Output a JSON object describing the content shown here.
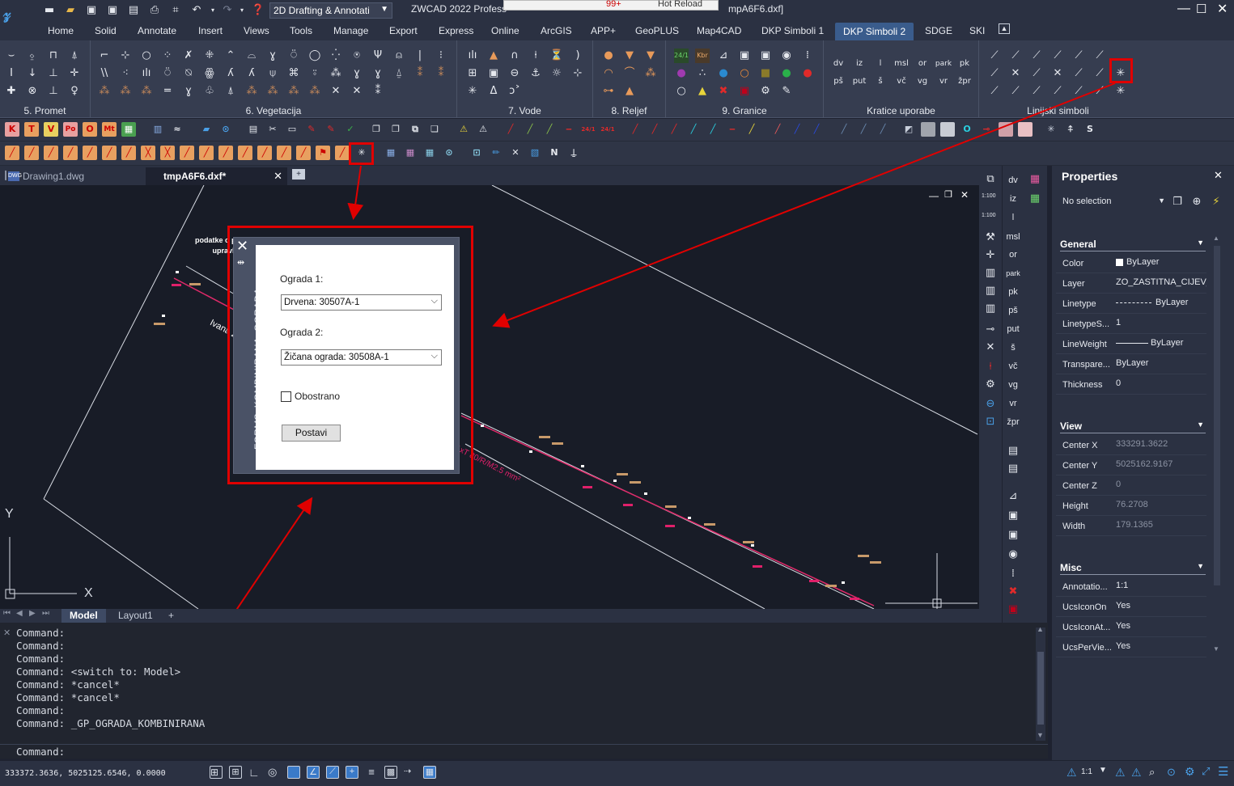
{
  "titlebar": {
    "workspace": "2D Drafting & Annotati",
    "app_title": "ZWCAD 2022 Profess",
    "center_badge": "99+",
    "hot_reload": "Hot Reload",
    "file_title_suffix": "mpA6F6.dxf]"
  },
  "ribbon_tabs": [
    "Home",
    "Solid",
    "Annotate",
    "Insert",
    "Views",
    "Tools",
    "Manage",
    "Export",
    "Express",
    "Online",
    "ArcGIS",
    "APP+",
    "GeoPLUS",
    "Map4CAD",
    "DKP Simboli 1",
    "DKP Simboli 2",
    "SDGE",
    "SKI"
  ],
  "active_tab": "DKP Simboli 2",
  "ribbon_groups": [
    "5. Promet",
    "6. Vegetacija",
    "7. Vode",
    "8. Reljef",
    "9. Granice",
    "Kratice uporabe",
    "Linijski simboli"
  ],
  "kratice": [
    "dv",
    "iz",
    "l",
    "msl",
    "or",
    "park",
    "pk",
    "pš",
    "put",
    "š",
    "vč",
    "vg",
    "vr",
    "žpr"
  ],
  "granice_labels": [
    "24/1",
    "Kbr"
  ],
  "document_tabs": [
    {
      "label": "Drawing1.dwg",
      "active": false
    },
    {
      "label": "tmpA6F6.dxf*",
      "active": true
    }
  ],
  "drawing": {
    "note_line1": "podatke o pos",
    "note_line2": "upravlj",
    "street_label": "Ivana Z",
    "cable_label": "1xT 80/R/M2.5 mm²",
    "axis_y": "Y",
    "axis_x": "X"
  },
  "layout_tabs": [
    "Model",
    "Layout1",
    "+"
  ],
  "dialog": {
    "side_title": "FORMS_KOMBINIRANA_OGRADA",
    "label1": "Ograda 1:",
    "select1": "Drvena: 30507A-1",
    "label2": "Ograda 2:",
    "select2": "Žičana ograda: 30508A-1",
    "checkbox_label": "Obostrano",
    "checkbox_checked": false,
    "button_label": "Postavi"
  },
  "command_history": [
    "Command:",
    "Command:",
    "Command:",
    "Command: <switch to: Model>",
    "Command: *cancel*",
    "Command: *cancel*",
    "Command:",
    "Command: _GP_OGRADA_KOMBINIRANA"
  ],
  "command_prompt": "Command:",
  "status": {
    "coords": "333372.3636, 5025125.6546, 0.0000",
    "scale": "1:1"
  },
  "right_strip_labels": [
    "dv",
    "iz",
    "l",
    "msl",
    "or",
    "park",
    "pk",
    "pš",
    "put",
    "š",
    "vč",
    "vg",
    "vr",
    "žpr"
  ],
  "strip_scale1": "1:100",
  "strip_scale2": "1:100",
  "properties": {
    "title": "Properties",
    "selection": "No selection",
    "sections": {
      "general": "General",
      "view": "View",
      "misc": "Misc"
    },
    "general": [
      {
        "key": "Color",
        "value": "ByLayer"
      },
      {
        "key": "Layer",
        "value": "ZO_ZASTITNA_CIJEV_I"
      },
      {
        "key": "Linetype",
        "value": "ByLayer"
      },
      {
        "key": "LinetypeS...",
        "value": "1"
      },
      {
        "key": "LineWeight",
        "value": "ByLayer"
      },
      {
        "key": "Transpare...",
        "value": "ByLayer"
      },
      {
        "key": "Thickness",
        "value": "0"
      }
    ],
    "view": [
      {
        "key": "Center X",
        "value": "333291.3622"
      },
      {
        "key": "Center Y",
        "value": "5025162.9167"
      },
      {
        "key": "Center Z",
        "value": "0"
      },
      {
        "key": "Height",
        "value": "76.2708"
      },
      {
        "key": "Width",
        "value": "179.1365"
      }
    ],
    "misc": [
      {
        "key": "Annotatio...",
        "value": "1:1"
      },
      {
        "key": "UcsIconOn",
        "value": "Yes"
      },
      {
        "key": "UcsIconAt...",
        "value": "Yes"
      },
      {
        "key": "UcsPerVie...",
        "value": "Yes"
      }
    ]
  },
  "colors": {
    "highlight": "#e00000",
    "active_tab": "#3a5c8c",
    "background": "#1e2230"
  }
}
